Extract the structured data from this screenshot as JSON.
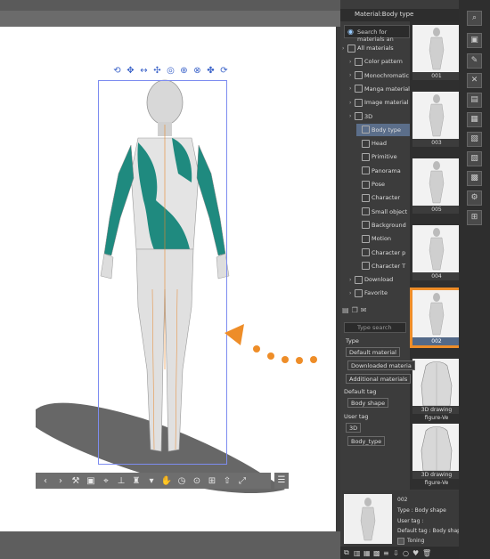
{
  "panel": {
    "title": "Material:Body type",
    "search_placeholder": "Search for materials an"
  },
  "tree": {
    "items": [
      {
        "label": "All materials",
        "indent": 0
      },
      {
        "label": "Color pattern",
        "indent": 1
      },
      {
        "label": "Monochromatic",
        "indent": 1
      },
      {
        "label": "Manga material",
        "indent": 1
      },
      {
        "label": "Image material",
        "indent": 1
      },
      {
        "label": "3D",
        "indent": 1
      },
      {
        "label": "Body type",
        "indent": 2,
        "selected": true
      },
      {
        "label": "Head",
        "indent": 2
      },
      {
        "label": "Primitive",
        "indent": 2
      },
      {
        "label": "Panorama",
        "indent": 2
      },
      {
        "label": "Pose",
        "indent": 2
      },
      {
        "label": "Character",
        "indent": 2
      },
      {
        "label": "Small object",
        "indent": 2
      },
      {
        "label": "Background",
        "indent": 2
      },
      {
        "label": "Motion",
        "indent": 2
      },
      {
        "label": "Character p",
        "indent": 2
      },
      {
        "label": "Character T",
        "indent": 2
      },
      {
        "label": "Download",
        "indent": 1
      },
      {
        "label": "Favorite",
        "indent": 1
      }
    ]
  },
  "thumbnails": [
    {
      "label": "001"
    },
    {
      "label": "003"
    },
    {
      "label": "005"
    },
    {
      "label": "004"
    },
    {
      "label": "002",
      "selected": true
    },
    {
      "label": "3D drawing figure-Ve"
    },
    {
      "label": "3D drawing figure-Ve"
    }
  ],
  "tags": {
    "search_placeholder": "Type search",
    "type_label": "Type",
    "type_buttons": [
      "Default material",
      "Downloaded materia",
      "Additional materials"
    ],
    "default_tag_label": "Default tag",
    "default_tag_value": "Body shape",
    "user_tag_label": "User tag",
    "user_tags": [
      "3D",
      "Body_type"
    ]
  },
  "details": {
    "name": "002",
    "type_line": "Type : Body shape",
    "user_tag_line": "User tag :",
    "default_tag_line": "Default tag : Body shape",
    "toning_label": "Toning"
  },
  "colors": {
    "accent_orange": "#ee8d28",
    "selection_blue": "#5b6e8a",
    "teal_pattern": "#1f8a7f",
    "bbox_blue": "#7d8cf0"
  }
}
